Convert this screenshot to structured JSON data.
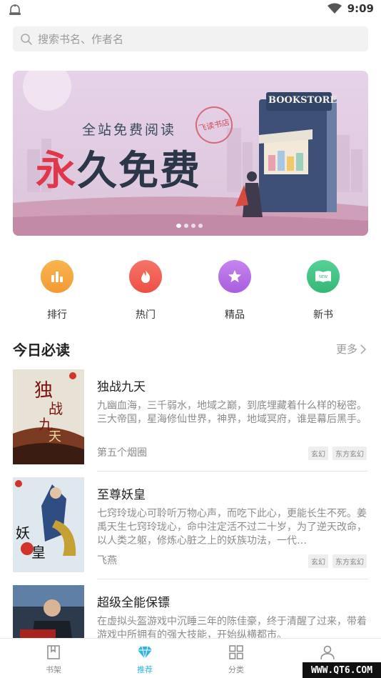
{
  "status_bar": {
    "time": "9:09",
    "left_icon": "app-notification-icon"
  },
  "search": {
    "placeholder": "搜索书名、作者名",
    "icon": "search-icon"
  },
  "banner": {
    "subtitle": "全站免费阅读",
    "title_first_char": "永",
    "title_rest": "久免费",
    "stamp_text": "飞读书店",
    "store_sign": "BOOKSTORE",
    "slide_count": 4,
    "active_slide": 1
  },
  "quick_nav": [
    {
      "label": "排行",
      "icon": "bar-chart-icon",
      "color": "#f5a23b"
    },
    {
      "label": "热门",
      "icon": "flame-icon",
      "color": "#f05a4e"
    },
    {
      "label": "精品",
      "icon": "star-icon",
      "color": "#b76de6"
    },
    {
      "label": "新书",
      "icon": "new-book-icon",
      "color": "#3ec384"
    }
  ],
  "section": {
    "title": "今日必读",
    "more_label": "更多"
  },
  "books": [
    {
      "title": "独战九天",
      "description": "九幽血海，三千弱水，地域之巅，到底埋藏着什么样的秘密。三大帝国，星海修仙世界，神界，地域冥府，谁是幕后黑手。",
      "author": "第五个烟圈",
      "tags": [
        "玄幻",
        "东方玄幻"
      ]
    },
    {
      "title": "至尊妖皇",
      "description": "七窍玲珑心可聆听万物心声，而吃下此心，更能长生不死。姜禹天生七窍玲珑心，命中注定活不过二十岁，为了逆天改命，以人类之躯，修炼心脏之上的妖族功法，一代…",
      "author": "飞燕",
      "tags": [
        "玄幻",
        "东方玄幻"
      ]
    },
    {
      "title": "超级全能保镖",
      "description": "在虚拟头盔游戏中沉睡三年的陈佳豪，终于清醒了过来，带着游戏中所拥有的强大技能，开始纵横都市。",
      "author": "",
      "tags": []
    }
  ],
  "tab_bar": [
    {
      "label": "书架",
      "icon": "bookshelf-icon",
      "active": false
    },
    {
      "label": "推荐",
      "icon": "diamond-icon",
      "active": true
    },
    {
      "label": "分类",
      "icon": "grid-icon",
      "active": false
    },
    {
      "label": "",
      "icon": "user-icon",
      "active": false
    }
  ],
  "watermark": "WWW.QT6.COM",
  "colors": {
    "accent": "#2fb5e3",
    "banner_bg": "#e7d3e8"
  }
}
